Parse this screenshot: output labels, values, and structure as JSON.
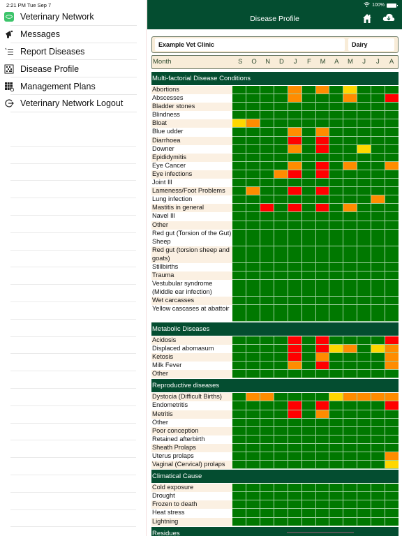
{
  "status_bar": {
    "time": "2:21 PM  Tue Sep 7",
    "battery": "100%"
  },
  "sidebar": {
    "items": [
      {
        "label": "Veterinary Network",
        "icon": "vetnet-app-icon"
      },
      {
        "label": "Messages",
        "icon": "megaphone-icon"
      },
      {
        "label": "Report Diseases",
        "icon": "list-icon"
      },
      {
        "label": "Disease Profile",
        "icon": "grid-icon"
      },
      {
        "label": "Management Plans",
        "icon": "calendar-grid-icon"
      },
      {
        "label": "Veterinary Network Logout",
        "icon": "logout-icon"
      }
    ]
  },
  "header": {
    "title": "Disease Profile",
    "home_icon": "home-icon",
    "download_icon": "cloud-download-icon"
  },
  "info": {
    "clinic": "Example Vet Clinic",
    "type": "Dairy"
  },
  "month_header": {
    "label": "Month",
    "months": [
      "S",
      "O",
      "N",
      "D",
      "J",
      "F",
      "M",
      "A",
      "M",
      "J",
      "J",
      "A"
    ]
  },
  "legend_colors": {
    "g": "#007800",
    "o": "#ff8c00",
    "y": "#ffd700",
    "r": "#ff0000",
    "header": "#044d30"
  },
  "sections": [
    {
      "title": "Multi-factorial Disease Conditions",
      "rows": [
        {
          "name": "Abortions",
          "cells": "ggggogogyggg"
        },
        {
          "name": "Abscesses",
          "cells": "ggggogggoggr"
        },
        {
          "name": "Bladder stones",
          "cells": "gggggggggggg"
        },
        {
          "name": "Blindness",
          "cells": "gggggggggggg"
        },
        {
          "name": "Bloat",
          "cells": "yogggggggggg"
        },
        {
          "name": "Blue udder",
          "cells": "ggggogoggggg"
        },
        {
          "name": "Diarrhoea",
          "cells": "ggggrgrggggg"
        },
        {
          "name": "Downer",
          "cells": "ggggogrggygg"
        },
        {
          "name": "Epididymitis",
          "cells": "gggggggggggg"
        },
        {
          "name": "Eye Cancer",
          "cells": "ggggogrgoggo"
        },
        {
          "name": "Eye infections",
          "cells": "gggorgrggggg"
        },
        {
          "name": "Joint Ill",
          "cells": "gggggggggggg"
        },
        {
          "name": "Lameness/Foot Problems",
          "cells": "goggrgrggggg"
        },
        {
          "name": "Lung infection",
          "cells": "ggggggggggog"
        },
        {
          "name": "Mastitis in general",
          "cells": "ggrgrgrgoggg"
        },
        {
          "name": "Navel Ill",
          "cells": "gggggggggggg"
        },
        {
          "name": "Other",
          "cells": "gggggggggggg"
        },
        {
          "name": "Red gut (Torsion of the Gut) Sheep",
          "cells": "gggggggggggg",
          "tall": true
        },
        {
          "name": "Red gut (torsion sheep and goats)",
          "cells": "gggggggggggg",
          "tall": true
        },
        {
          "name": "Stillbirths",
          "cells": "gggggggggggg"
        },
        {
          "name": "Trauma",
          "cells": "gggggggggggg"
        },
        {
          "name": "Vestubular syndrome (Middle ear infection)",
          "cells": "gggggggggggg",
          "tall": true
        },
        {
          "name": "Wet carcasses",
          "cells": "gggggggggggg"
        },
        {
          "name": "Yellow cascases at abattoir",
          "cells": "gggggggggggg",
          "tall": true
        }
      ]
    },
    {
      "title": "Metabolic Diseases",
      "rows": [
        {
          "name": "Acidosis",
          "cells": "ggggrgrggggr"
        },
        {
          "name": "Displaced abomasum",
          "cells": "ggggrgryogyo"
        },
        {
          "name": "Ketosis",
          "cells": "ggggrgoggggo"
        },
        {
          "name": "Milk Fever",
          "cells": "ggggogrggggo"
        },
        {
          "name": "Other",
          "cells": "gggggggggggg"
        }
      ]
    },
    {
      "title": "Reproductive diseases",
      "rows": [
        {
          "name": "Dystocia (Difficult Births)",
          "cells": "ggooggggyoooo"
        },
        {
          "name": "Endometritis",
          "cells": "ggggrgrggggr"
        },
        {
          "name": "Metritis",
          "cells": "ggggrgoggggg"
        },
        {
          "name": "Other",
          "cells": "gggggggggggg"
        },
        {
          "name": "Poor conception",
          "cells": "gggggggggggg"
        },
        {
          "name": "Retained afterbirth",
          "cells": "gggggggggggg"
        },
        {
          "name": "Sheath Prolaps",
          "cells": "gggggggggggg"
        },
        {
          "name": "Uterus prolaps",
          "cells": "ggggggggggggo"
        },
        {
          "name": "Vaginal (Cervical) prolaps",
          "cells": "ggggggggggggy"
        }
      ]
    },
    {
      "title": "Climatical Cause",
      "rows": [
        {
          "name": "Cold exposure",
          "cells": "gggggggggggg"
        },
        {
          "name": "Drought",
          "cells": "gggggggggggg"
        },
        {
          "name": "Frozen to death",
          "cells": "gggggggggggg"
        },
        {
          "name": "Heat stress",
          "cells": "gggggggggggg"
        },
        {
          "name": "Lightning",
          "cells": "gggggggggggg"
        }
      ]
    },
    {
      "title": "Residues",
      "rows": []
    }
  ]
}
